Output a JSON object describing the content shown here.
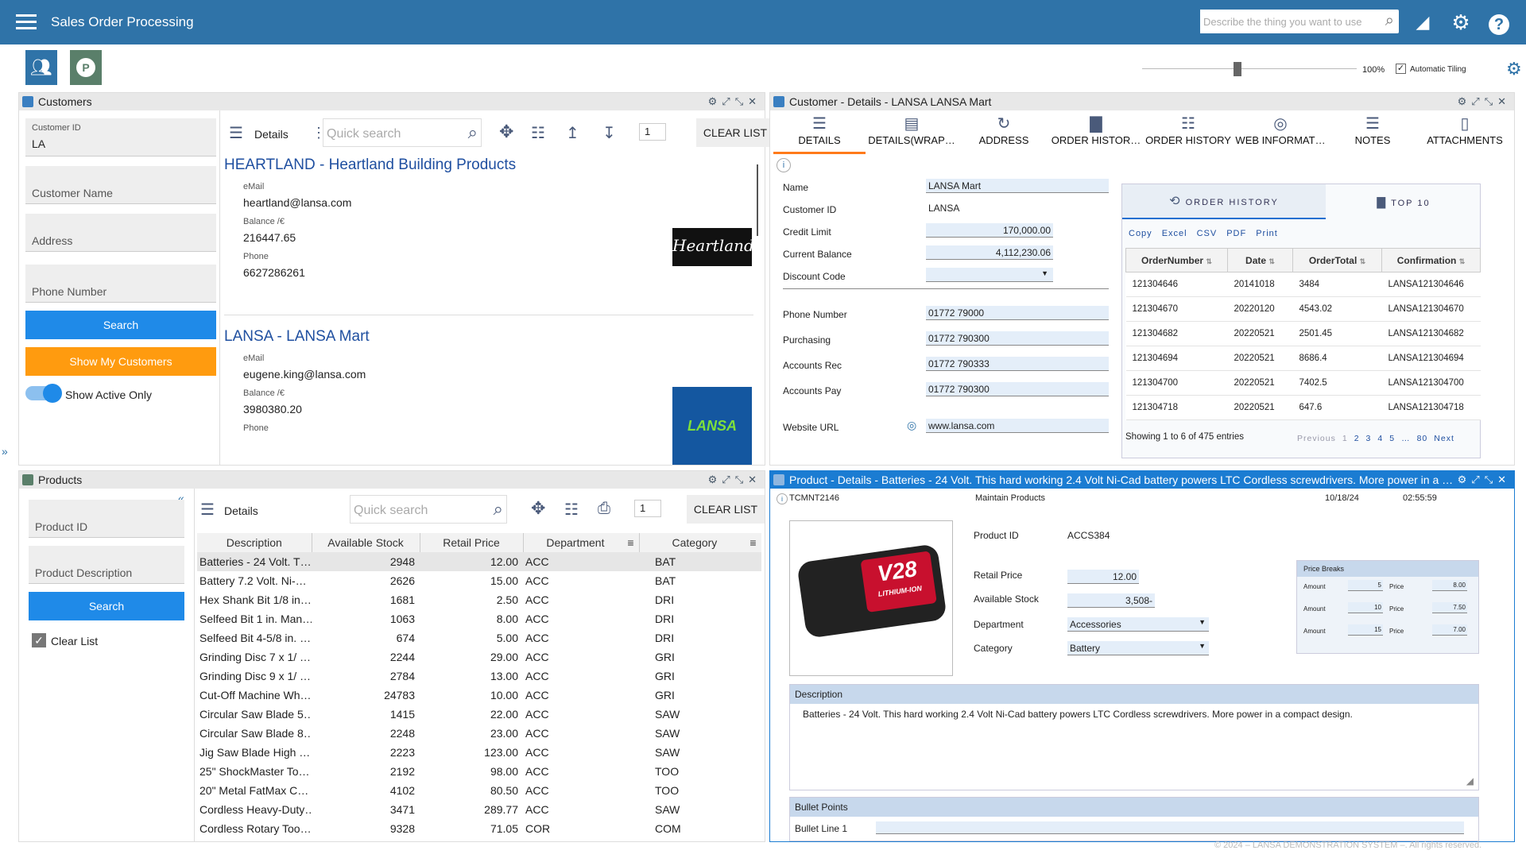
{
  "app": {
    "title": "Sales Order Processing",
    "search_placeholder": "Describe the thing you want to use",
    "zoom": "100%",
    "auto_tiling": "Automatic Tiling",
    "footer": "© 2024 – LANSA DEMONSTRATION SYSTEM –. All rights reserved."
  },
  "customers": {
    "title": "Customers",
    "customer_id_label": "Customer ID",
    "customer_id_value": "LA",
    "name_label": "Customer Name",
    "address_label": "Address",
    "phone_label": "Phone Number",
    "search_btn": "Search",
    "show_my_btn": "Show My Customers",
    "active_only": "Show Active Only",
    "details_label": "Details",
    "quick_search": "Quick search",
    "page_num": "1",
    "clear_list": "CLEAR LIST",
    "cards": [
      {
        "title": "HEARTLAND - Heartland Building Products",
        "email_label": "eMail",
        "email": "heartland@lansa.com",
        "balance_label": "Balance /€",
        "balance": "216447.65",
        "phone_label": "Phone",
        "phone": "6627286261",
        "logo": "Heartland"
      },
      {
        "title": "LANSA - LANSA Mart",
        "email_label": "eMail",
        "email": "eugene.king@lansa.com",
        "balance_label": "Balance /€",
        "balance": "3980380.20",
        "phone_label": "Phone",
        "phone": "",
        "logo": "LANSA Mart"
      }
    ]
  },
  "products": {
    "title": "Products",
    "id_label": "Product ID",
    "desc_label": "Product Description",
    "search_btn": "Search",
    "clear_list_chk": "Clear List",
    "details_label": "Details",
    "quick_search": "Quick search",
    "page_num": "1",
    "clear_list": "CLEAR LIST",
    "columns": [
      "Description",
      "Available Stock",
      "Retail Price",
      "Department",
      "Category"
    ],
    "rows": [
      [
        "Batteries - 24 Volt. T…",
        "2948",
        "12.00",
        "ACC",
        "BAT"
      ],
      [
        "Battery 7.2 Volt. Ni-…",
        "2626",
        "15.00",
        "ACC",
        "BAT"
      ],
      [
        "Hex Shank Bit 1/8 in…",
        "1681",
        "2.50",
        "ACC",
        "DRI"
      ],
      [
        "Selfeed Bit 1 in. Man…",
        "1063",
        "8.00",
        "ACC",
        "DRI"
      ],
      [
        "Selfeed Bit 4-5/8 in. …",
        "674",
        "5.00",
        "ACC",
        "DRI"
      ],
      [
        "Grinding Disc 7 x 1/ …",
        "2244",
        "29.00",
        "ACC",
        "GRI"
      ],
      [
        "Grinding Disc 9 x 1/ …",
        "2784",
        "13.00",
        "ACC",
        "GRI"
      ],
      [
        "Cut-Off Machine Wh…",
        "24783",
        "10.00",
        "ACC",
        "GRI"
      ],
      [
        "Circular Saw Blade 5…",
        "1415",
        "22.00",
        "ACC",
        "SAW"
      ],
      [
        "Circular Saw Blade 8…",
        "2248",
        "23.00",
        "ACC",
        "SAW"
      ],
      [
        "Jig Saw Blade High …",
        "2223",
        "123.00",
        "ACC",
        "SAW"
      ],
      [
        "25\" ShockMaster To…",
        "2192",
        "98.00",
        "ACC",
        "TOO"
      ],
      [
        "20\" Metal FatMax C…",
        "4102",
        "80.50",
        "ACC",
        "TOO"
      ],
      [
        "Cordless Heavy-Duty…",
        "3471",
        "289.77",
        "ACC",
        "SAW"
      ],
      [
        "Cordless Rotary Too…",
        "9328",
        "71.05",
        "COR",
        "COM"
      ]
    ]
  },
  "cust_details": {
    "title": "Customer - Details - LANSA LANSA Mart",
    "tabs": [
      "DETAILS",
      "DETAILS(WRAP…",
      "ADDRESS",
      "ORDER HISTOR…",
      "ORDER HISTORY",
      "WEB INFORMAT…",
      "NOTES",
      "ATTACHMENTS"
    ],
    "fields": [
      {
        "label": "Name",
        "value": "LANSA Mart"
      },
      {
        "label": "Customer ID",
        "value": "LANSA"
      },
      {
        "label": "Credit Limit",
        "value": "170,000.00"
      },
      {
        "label": "Current Balance",
        "value": "4,112,230.06"
      },
      {
        "label": "Discount Code",
        "value": ""
      },
      {
        "label": "Phone Number",
        "value": "01772 79000"
      },
      {
        "label": "Purchasing",
        "value": "01772 790300"
      },
      {
        "label": "Accounts Rec",
        "value": "01772 790333"
      },
      {
        "label": "Accounts Pay",
        "value": "01772 790300"
      },
      {
        "label": "Website URL",
        "value": "www.lansa.com"
      }
    ],
    "oh_tab1": "ORDER HISTORY",
    "oh_tab2": "TOP 10",
    "export": [
      "Copy",
      "Excel",
      "CSV",
      "PDF",
      "Print"
    ],
    "oh_cols": [
      "OrderNumber",
      "Date",
      "OrderTotal",
      "Confirmation"
    ],
    "oh_rows": [
      [
        "121304646",
        "20141018",
        "3484",
        "LANSA121304646"
      ],
      [
        "121304670",
        "20220120",
        "4543.02",
        "LANSA121304670"
      ],
      [
        "121304682",
        "20220521",
        "2501.45",
        "LANSA121304682"
      ],
      [
        "121304694",
        "20220521",
        "8686.4",
        "LANSA121304694"
      ],
      [
        "121304700",
        "20220521",
        "7402.5",
        "LANSA121304700"
      ],
      [
        "121304718",
        "20220521",
        "647.6",
        "LANSA121304718"
      ]
    ],
    "showing": "Showing 1 to 6 of 475 entries",
    "pager": [
      "Previous",
      "1",
      "2",
      "3",
      "4",
      "5",
      "…",
      "80",
      "Next"
    ]
  },
  "prod_details": {
    "title": "Product - Details - Batteries - 24 Volt. This hard working 2.4 Volt Ni-Cad battery powers LTC Cordless screwdrivers. More power in a …",
    "code": "TCMNT2146",
    "maintain": "Maintain Products",
    "date": "10/18/24",
    "time": "02:55:59",
    "id_label": "Product ID",
    "id_value": "ACCS384",
    "price_label": "Retail Price",
    "price_value": "12.00",
    "stock_label": "Available Stock",
    "stock_value": "3,508-",
    "dept_label": "Department",
    "dept_value": "Accessories",
    "cat_label": "Category",
    "cat_value": "Battery",
    "pb_title": "Price Breaks",
    "price_breaks": [
      {
        "amount_label": "Amount",
        "amount": "5",
        "price_label": "Price",
        "price": "8.00"
      },
      {
        "amount_label": "Amount",
        "amount": "10",
        "price_label": "Price",
        "price": "7.50"
      },
      {
        "amount_label": "Amount",
        "amount": "15",
        "price_label": "Price",
        "price": "7.00"
      }
    ],
    "desc_label": "Description",
    "desc": "Batteries - 24 Volt. This hard working 2.4 Volt Ni-Cad battery powers LTC Cordless screwdrivers. More power in a compact design.",
    "bullet_label": "Bullet Points",
    "bullet1_label": "Bullet Line 1",
    "battery_text": "V28",
    "battery_sub": "LITHIUM-ION"
  }
}
